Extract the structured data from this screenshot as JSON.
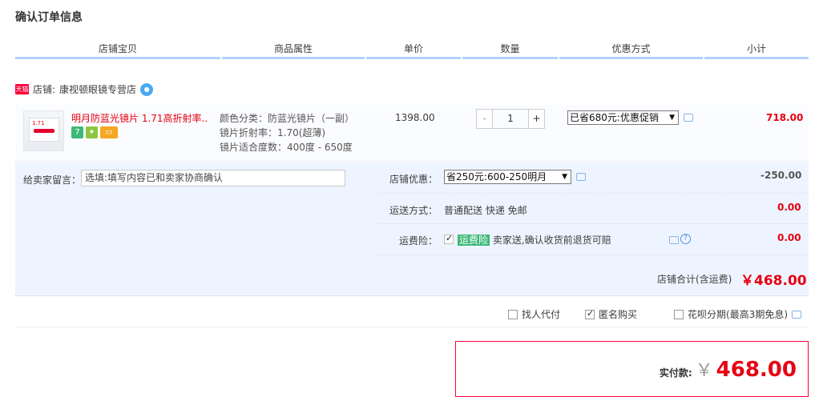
{
  "page_title": "确认订单信息",
  "columns": [
    "店铺宝贝",
    "商品属性",
    "单价",
    "数量",
    "优惠方式",
    "小计"
  ],
  "store": {
    "badge": "天猫",
    "label": "店铺:",
    "name": "康视顿眼镜专营店"
  },
  "item": {
    "name": "明月防蓝光镜片 1.71高折射率...",
    "attrs": [
      "颜色分类：防蓝光镜片（一副）",
      "镜片折射率：1.70(超薄)",
      "镜片适合度数：400度 - 650度"
    ],
    "price": "1398.00",
    "qty": "1",
    "qty_minus": "-",
    "qty_plus": "+",
    "discount_select": "已省680元:优惠促销",
    "subtotal": "718.00",
    "thumb_text": "1.71"
  },
  "message": {
    "label": "给卖家留言：",
    "placeholder": "选填:填写内容已和卖家协商确认"
  },
  "store_discount": {
    "label": "店铺优惠：",
    "select": "省250元:600-250明月",
    "amount": "-250.00"
  },
  "shipping": {
    "label": "运送方式：",
    "value": "普通配送 快递 免邮",
    "amount": "0.00"
  },
  "insurance": {
    "label": "运费险：",
    "tag": "运费险",
    "desc": "卖家送,确认收货前退货可赔",
    "amount": "0.00"
  },
  "store_total": {
    "label": "店铺合计(含运费)",
    "value": "￥468.00"
  },
  "options": [
    {
      "label": "找人代付",
      "checked": false
    },
    {
      "label": "匿名购买",
      "checked": true
    },
    {
      "label": "花呗分期(最高3期免息)",
      "checked": false
    }
  ],
  "pay": {
    "label": "实付款:",
    "currency": "￥",
    "value": "468.00"
  },
  "colors": {
    "accent_red": "#e60012",
    "header_line": "#b2d1ff",
    "panel_bg": "#eef4ff"
  }
}
